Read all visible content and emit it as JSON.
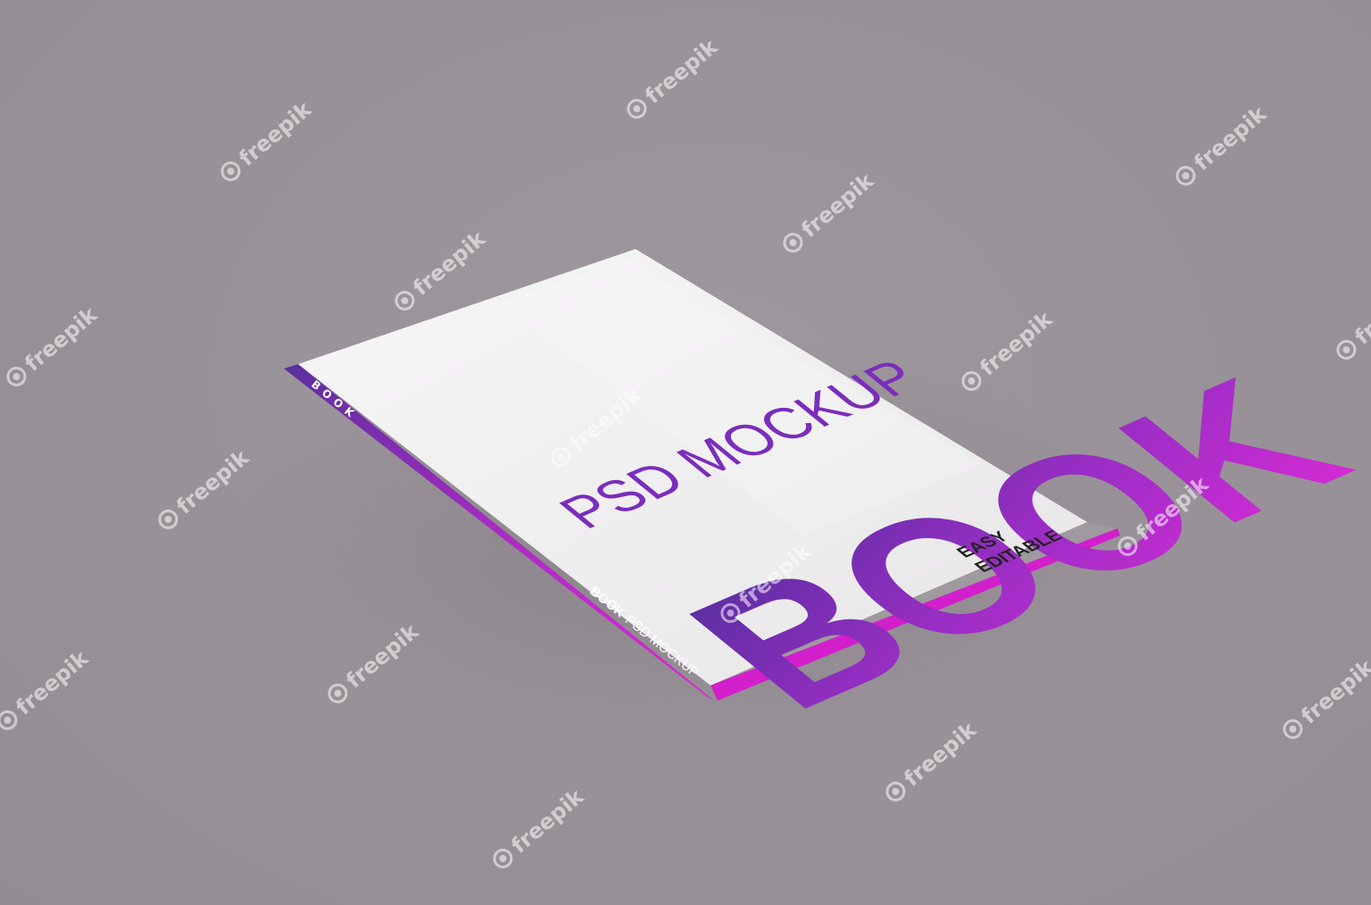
{
  "cover": {
    "big_title": "BOOK",
    "subtitle": "PSD MOCKUP",
    "corner_line1": "EASY",
    "corner_line2": "EDITABLE"
  },
  "spine": {
    "top_text": "BOOK",
    "bottom_bold": "BOOK",
    "bottom_rest": "PSD MOCKUP"
  },
  "watermark": {
    "text": "freepik",
    "icon": "freepik-logo-icon"
  },
  "colors": {
    "background": "#999399",
    "cover": "#f4f2f4",
    "purple": "#5a2f9e",
    "magenta": "#e025d6",
    "pages": "#9e9a9e"
  }
}
